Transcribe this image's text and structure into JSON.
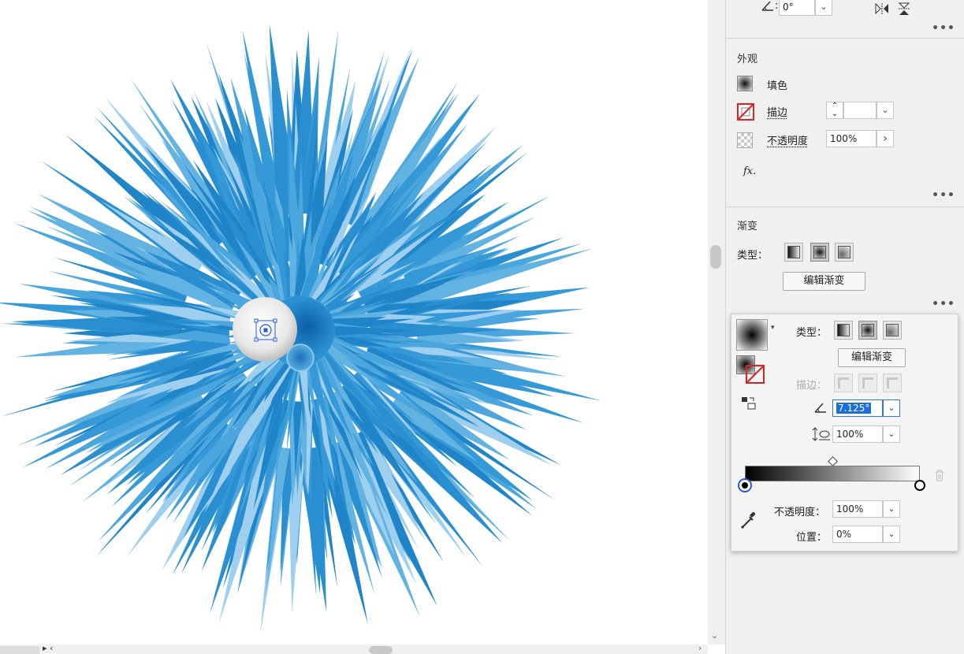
{
  "top_toolbar": {
    "angle_value": "0°"
  },
  "appearance": {
    "title": "外观",
    "fill_label": "填色",
    "stroke_label": "描边",
    "opacity_label": "不透明度",
    "opacity_value": "100%",
    "fx_label": "fx."
  },
  "gradient": {
    "title": "渐变",
    "type_label": "类型：",
    "edit_button": "编辑渐变"
  },
  "popup": {
    "type_label": "类型：",
    "edit_button": "编辑渐变",
    "stroke_label": "描边：",
    "angle_value": "7.125°",
    "aspect_value": "100%",
    "opacity_label": "不透明度：",
    "opacity_value": "100%",
    "position_label": "位置：",
    "position_value": "0%"
  },
  "colors": {
    "artwork_blue": "#2a8fd0",
    "selection_blue": "#2a5bd7"
  },
  "icons": [
    "angle-icon",
    "chevron-down-icon",
    "flip-horizontal-icon",
    "flip-vertical-icon",
    "more-icon",
    "fill-swatch-icon",
    "stroke-none-icon",
    "opacity-checker-icon",
    "fx-icon",
    "chevron-right-icon",
    "trash-icon",
    "eyedropper-icon",
    "aspect-ratio-icon"
  ]
}
